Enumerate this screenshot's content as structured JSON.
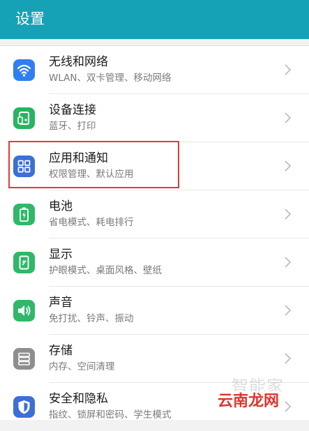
{
  "appbar": {
    "title": "设置"
  },
  "settings": [
    {
      "title": "无线和网络",
      "subtitle": "WLAN、双卡管理、移动网络",
      "icon": "wifi-icon",
      "color": "#2f7ff0"
    },
    {
      "title": "设备连接",
      "subtitle": "蓝牙、打印",
      "icon": "device-connection-icon",
      "color": "#28b463"
    },
    {
      "title": "应用和通知",
      "subtitle": "权限管理、默认应用",
      "icon": "apps-icon",
      "color": "#3d6fd6"
    },
    {
      "title": "电池",
      "subtitle": "省电模式、耗电排行",
      "icon": "battery-icon",
      "color": "#2fb86a"
    },
    {
      "title": "显示",
      "subtitle": "护眼模式、桌面风格、壁纸",
      "icon": "display-icon",
      "color": "#2fb86a"
    },
    {
      "title": "声音",
      "subtitle": "免打扰、铃声、振动",
      "icon": "sound-icon",
      "color": "#2fb86a"
    },
    {
      "title": "存储",
      "subtitle": "内存、空间清理",
      "icon": "storage-icon",
      "color": "#8e8e8e"
    },
    {
      "title": "安全和隐私",
      "subtitle": "指纹、锁屏和密码、学生模式",
      "icon": "shield-icon",
      "color": "#3d6fd6"
    }
  ],
  "watermark": {
    "light": "智能家",
    "brand": "云南龙网"
  }
}
